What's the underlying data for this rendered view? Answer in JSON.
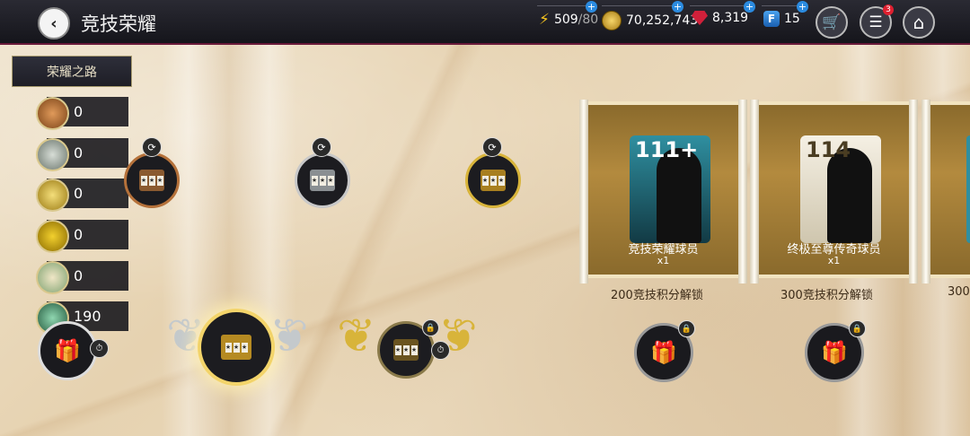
{
  "header": {
    "title": "竞技荣耀",
    "back_icon": "‹"
  },
  "resources": {
    "energy": {
      "value": "509",
      "max": "/80"
    },
    "coins": {
      "value": "70,252,743"
    },
    "gems": {
      "value": "8,319"
    },
    "fifa_points": {
      "value": "15",
      "icon": "F"
    },
    "plus": "+"
  },
  "toolbar": {
    "notification_count": "3",
    "cart_icon": "🛒",
    "tasks_icon": "☰",
    "home_icon": "⌂"
  },
  "sidebar": {
    "tab_label": "荣耀之路",
    "counters": [
      {
        "name": "bronze-medal",
        "value": "0",
        "color": "#b5713a"
      },
      {
        "name": "silver-medal",
        "value": "0",
        "color": "#a5b0a8"
      },
      {
        "name": "gold-medal",
        "value": "0",
        "color": "#d8b43a"
      },
      {
        "name": "elite-medal",
        "value": "0",
        "color": "#c9a521"
      },
      {
        "name": "crest-medal",
        "value": "0",
        "color": "#7fa372"
      },
      {
        "name": "champion-medal",
        "value": "190",
        "color": "#3a7c5a"
      }
    ]
  },
  "cards": [
    {
      "rating": "111+",
      "name": "竞技荣耀球员",
      "qty": "x1",
      "unlock": "200竞技积分解锁"
    },
    {
      "rating": "114",
      "name": "终极至尊传奇球员",
      "qty": "x1",
      "unlock": "300竞技积分解锁"
    },
    {
      "unlock": "300"
    }
  ],
  "slot_glyph": "★"
}
